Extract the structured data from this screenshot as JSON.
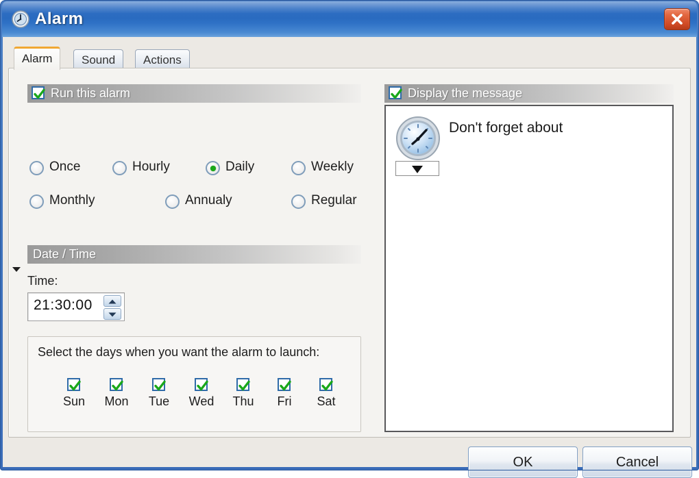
{
  "window": {
    "title": "Alarm",
    "icon": "clock-icon",
    "close_label": "×",
    "frame_color": "#3f73bd"
  },
  "tabs": [
    {
      "label": "Alarm",
      "active": true
    },
    {
      "label": "Sound",
      "active": false
    },
    {
      "label": "Actions",
      "active": false
    }
  ],
  "run_alarm": {
    "label": "Run this alarm",
    "checked": true
  },
  "schedule": {
    "selected": "Daily",
    "options": [
      {
        "label": "Once",
        "selected": false
      },
      {
        "label": "Hourly",
        "selected": false
      },
      {
        "label": "Daily",
        "selected": true
      },
      {
        "label": "Weekly",
        "selected": false
      },
      {
        "label": "Monthly",
        "selected": false
      },
      {
        "label": "Annualy",
        "selected": false
      },
      {
        "label": "Regular",
        "selected": false
      }
    ]
  },
  "date_time": {
    "header": "Date / Time",
    "time_label": "Time:",
    "time_value": "21:30:00",
    "spinner_up": "up-arrow-icon",
    "spinner_down": "down-arrow-icon"
  },
  "days": {
    "title": "Select the days when you want the alarm to launch:",
    "items": [
      {
        "name": "Sun",
        "checked": true
      },
      {
        "name": "Mon",
        "checked": true
      },
      {
        "name": "Tue",
        "checked": true
      },
      {
        "name": "Wed",
        "checked": true
      },
      {
        "name": "Thu",
        "checked": true
      },
      {
        "name": "Fri",
        "checked": true
      },
      {
        "name": "Sat",
        "checked": true
      }
    ]
  },
  "message": {
    "header": "Display the message",
    "checked": true,
    "icon": "clock-icon",
    "text": "Don't forget about"
  },
  "footer": {
    "ok_label": "OK",
    "cancel_label": "Cancel"
  },
  "colors": {
    "titlebar_blue": "#2a6bc0",
    "tab_accent_orange": "#f0a732",
    "check_green": "#1aa81a",
    "radio_green": "#1aa81a",
    "close_red": "#cf4a24"
  }
}
